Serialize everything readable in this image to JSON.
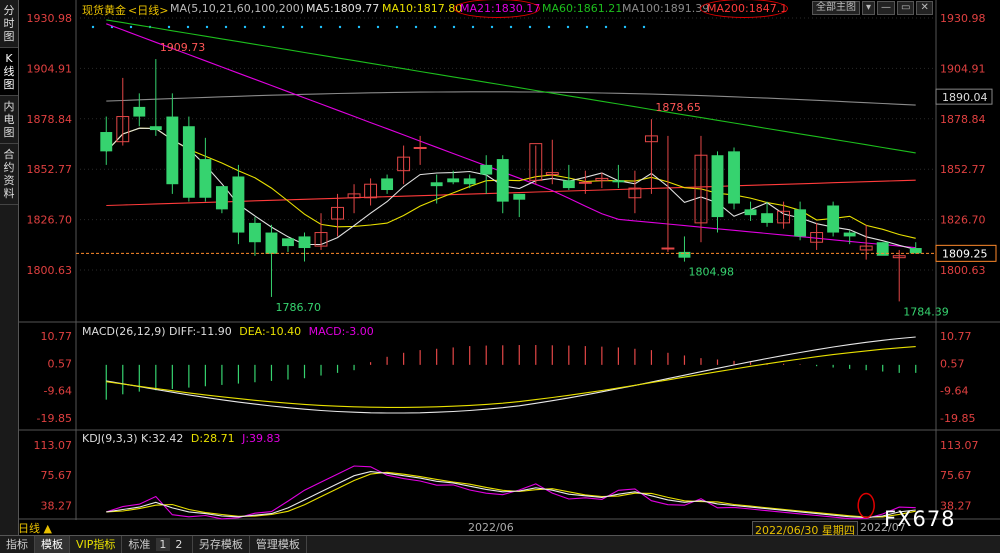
{
  "app": {
    "instrument": "现货黄金",
    "period_tag": "<日线>",
    "period_label": "日线"
  },
  "sidebar": {
    "tabs": [
      "分时图",
      "K线图",
      "内电图",
      "合约资料"
    ]
  },
  "header": {
    "ma_params": "MA(5,10,21,60,100,200)",
    "ma5": "MA5:1809.77",
    "ma10": "MA10:1817.80",
    "ma21": "MA21:1830.17",
    "ma60": "MA60:1861.21",
    "ma100": "MA100:1891.39",
    "ma200": "MA200:1847.1",
    "control_label": "全部主图"
  },
  "colors": {
    "up": "#36d36f",
    "down": "#e44747",
    "ma5": "#e0e0e0",
    "ma10": "#e8e000",
    "ma21": "#e000e0",
    "ma60": "#1dbe1d",
    "ma100": "#8a8a8a",
    "ma200": "#ff3b3b",
    "price_line": "#ff8a2b"
  },
  "price_axis": {
    "ticks": [
      "1930.98",
      "1904.91",
      "1878.84",
      "1852.77",
      "1826.70",
      "1800.63"
    ],
    "current": "1809.25",
    "ma100_tag": "1890.04"
  },
  "annotations": {
    "high1": "1909.73",
    "low1": "1786.70",
    "high2": "1878.65",
    "low2": "1804.98",
    "low3": "1784.39"
  },
  "macd": {
    "label": "MACD(26,12,9)",
    "diff": "DIFF:-11.90",
    "dea": "DEA:-10.40",
    "macd": "MACD:-3.00",
    "ticks": [
      "10.77",
      "0.57",
      "-9.64",
      "-19.85"
    ]
  },
  "kdj": {
    "label": "KDJ(9,3,3)",
    "k": "K:32.42",
    "d": "D:28.71",
    "j": "J:39.83",
    "ticks": [
      "113.07",
      "75.67",
      "38.27"
    ]
  },
  "date_axis": {
    "month_label": "2022/06",
    "cursor_date": "2022/06/30 星期四",
    "next_label": "2022/07"
  },
  "bottom_tabs": {
    "t1": "指标",
    "t2": "模板",
    "t3": "VIP指标",
    "t4": "标准",
    "p1": "1",
    "p2": "2",
    "t5": "另存模板",
    "t6": "管理模板"
  },
  "watermark": "FX678",
  "chart_data": {
    "type": "candlestick",
    "ohlc": [
      [
        1872,
        1880,
        1855,
        1862
      ],
      [
        1867,
        1900,
        1865,
        1880
      ],
      [
        1885,
        1892,
        1875,
        1880
      ],
      [
        1875,
        1909.73,
        1870,
        1873
      ],
      [
        1880,
        1892,
        1840,
        1845
      ],
      [
        1875,
        1880,
        1836,
        1838
      ],
      [
        1858,
        1869,
        1836,
        1838
      ],
      [
        1844,
        1844,
        1830,
        1832
      ],
      [
        1849,
        1855,
        1814,
        1820
      ],
      [
        1825,
        1828,
        1808,
        1815
      ],
      [
        1820,
        1824,
        1786.7,
        1809
      ],
      [
        1817,
        1817,
        1810,
        1813
      ],
      [
        1818,
        1820,
        1805,
        1812
      ],
      [
        1813,
        1830,
        1811,
        1820
      ],
      [
        1827,
        1840,
        1818,
        1833
      ],
      [
        1838,
        1845,
        1830,
        1840
      ],
      [
        1838,
        1848,
        1834,
        1845
      ],
      [
        1848,
        1850,
        1840,
        1842
      ],
      [
        1852,
        1865,
        1845,
        1859
      ],
      [
        1864,
        1870,
        1855,
        1864
      ],
      [
        1846,
        1850,
        1835,
        1844
      ],
      [
        1848,
        1852,
        1845,
        1846
      ],
      [
        1848,
        1850,
        1843,
        1845
      ],
      [
        1855,
        1860,
        1840,
        1850
      ],
      [
        1858,
        1860,
        1830,
        1836
      ],
      [
        1840,
        1840,
        1828,
        1837
      ],
      [
        1847,
        1865,
        1845,
        1866
      ],
      [
        1850,
        1868,
        1845,
        1851
      ],
      [
        1847,
        1855,
        1842,
        1843
      ],
      [
        1846,
        1852,
        1840,
        1846
      ],
      [
        1847,
        1851,
        1843,
        1848
      ],
      [
        1847,
        1855,
        1843,
        1846
      ],
      [
        1838,
        1852,
        1830,
        1843
      ],
      [
        1867,
        1878.65,
        1840,
        1870
      ],
      [
        1812,
        1870,
        1810,
        1812
      ],
      [
        1810,
        1818,
        1804.98,
        1807
      ],
      [
        1825,
        1870,
        1815,
        1860
      ],
      [
        1860,
        1862,
        1820,
        1828
      ],
      [
        1862,
        1864,
        1832,
        1835
      ],
      [
        1832,
        1836,
        1826,
        1829
      ],
      [
        1830,
        1836,
        1823,
        1825
      ],
      [
        1825,
        1836,
        1822,
        1831
      ],
      [
        1832,
        1836,
        1816,
        1818
      ],
      [
        1815,
        1825,
        1811,
        1820
      ],
      [
        1834,
        1836,
        1818,
        1820
      ],
      [
        1820,
        1821,
        1814,
        1818
      ],
      [
        1811,
        1824,
        1806,
        1813
      ],
      [
        1815,
        1815,
        1809,
        1808
      ],
      [
        1807,
        1811,
        1784.39,
        1808
      ],
      [
        1812,
        1815,
        1809,
        1809.25
      ]
    ],
    "ylim": [
      1784.39,
      1930.98
    ],
    "macd_hist": [
      -13,
      -11,
      -10,
      -9.5,
      -9,
      -8.5,
      -8,
      -7.5,
      -7,
      -6.5,
      -6,
      -5.5,
      -5,
      -4,
      -3,
      -2,
      1,
      3,
      4.5,
      5.5,
      6,
      6.5,
      7,
      7.2,
      7.3,
      7.4,
      7.4,
      7.3,
      7.2,
      7,
      6.8,
      6.5,
      6,
      5.5,
      4.5,
      3.5,
      2.5,
      2,
      1.5,
      1,
      0.6,
      0.4,
      0.2,
      -0.5,
      -1,
      -1.5,
      -2,
      -2.5,
      -3,
      -3
    ],
    "kdj_k": [
      30,
      33,
      36,
      42,
      35,
      30,
      28,
      25,
      24,
      26,
      28,
      35,
      45,
      55,
      65,
      75,
      80,
      78,
      75,
      72,
      68,
      66,
      62,
      58,
      55,
      56,
      60,
      57,
      52,
      50,
      48,
      52,
      55,
      50,
      45,
      42,
      44,
      40,
      38,
      36,
      34,
      32,
      30,
      28,
      26,
      24,
      23,
      25,
      30,
      32.42
    ]
  }
}
